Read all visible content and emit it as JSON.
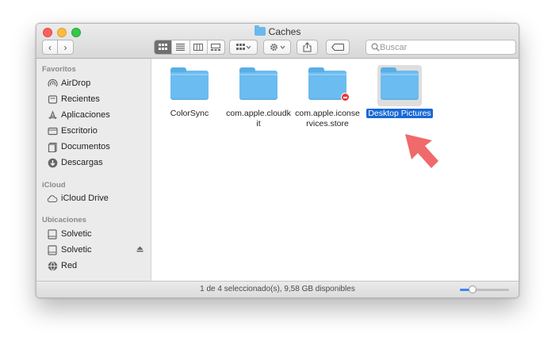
{
  "window": {
    "title": "Caches"
  },
  "toolbar": {
    "back_icon": "‹",
    "forward_icon": "›",
    "search_placeholder": "Buscar"
  },
  "sidebar": {
    "sections": [
      {
        "header": "Favoritos",
        "items": [
          {
            "label": "AirDrop",
            "icon": "airdrop-icon"
          },
          {
            "label": "Recientes",
            "icon": "recents-icon"
          },
          {
            "label": "Aplicaciones",
            "icon": "applications-icon"
          },
          {
            "label": "Escritorio",
            "icon": "desktop-icon"
          },
          {
            "label": "Documentos",
            "icon": "documents-icon"
          },
          {
            "label": "Descargas",
            "icon": "downloads-icon"
          }
        ]
      },
      {
        "header": "iCloud",
        "items": [
          {
            "label": "iCloud Drive",
            "icon": "cloud-icon"
          }
        ]
      },
      {
        "header": "Ubicaciones",
        "items": [
          {
            "label": "Solvetic",
            "icon": "disk-icon"
          },
          {
            "label": "Solvetic",
            "icon": "disk-icon",
            "eject": true
          },
          {
            "label": "Red",
            "icon": "network-icon"
          }
        ]
      }
    ]
  },
  "files": [
    {
      "name": "ColorSync",
      "selected": false,
      "badge": false
    },
    {
      "name": "com.apple.cloudkit",
      "selected": false,
      "badge": false
    },
    {
      "name": "com.apple.iconservices.store",
      "selected": false,
      "badge": true
    },
    {
      "name": "Desktop Pictures",
      "selected": true,
      "badge": false
    }
  ],
  "status": {
    "text": "1 de 4 seleccionado(s), 9,58 GB disponibles",
    "zoom_level": 0.25
  },
  "colors": {
    "folder": "#6bbcf0",
    "selection": "#1868d6",
    "arrow": "#f0696b"
  }
}
